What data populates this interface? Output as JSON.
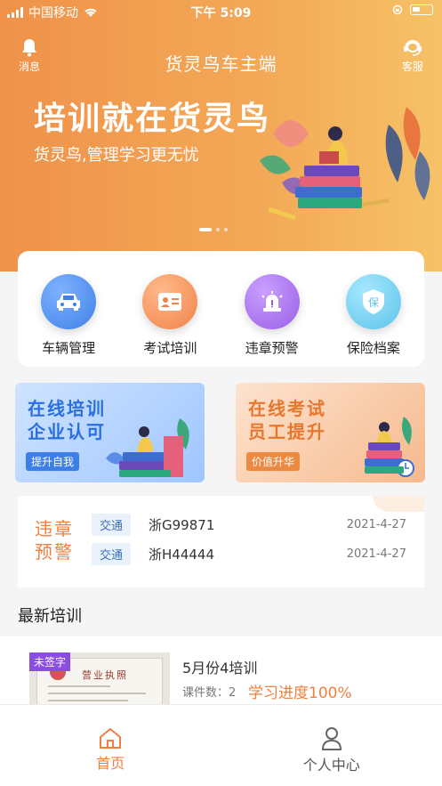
{
  "status_bar": {
    "carrier": "中国移动",
    "time": "下午 5:09"
  },
  "header": {
    "title": "货灵鸟车主端",
    "messages_label": "消息",
    "service_label": "客服"
  },
  "banner": {
    "headline": "培训就在货灵鸟",
    "subline": "货灵鸟,管理学习更无忧",
    "page_count": 3,
    "active_page": 1
  },
  "quick_entries": [
    {
      "label": "车辆管理",
      "icon": "car-icon",
      "color": "#3f80e8"
    },
    {
      "label": "考试培训",
      "icon": "id-card-icon",
      "color": "#f0834a"
    },
    {
      "label": "违章预警",
      "icon": "siren-icon",
      "color": "#9a5de6"
    },
    {
      "label": "保险档案",
      "icon": "shield-icon",
      "color": "#5cc3e8",
      "badge": "保"
    }
  ],
  "promos": [
    {
      "title_line1": "在线培训",
      "title_line2": "企业认可",
      "tag": "提升自我"
    },
    {
      "title_line1": "在线考试",
      "title_line2": "员工提升",
      "tag": "价值升华"
    }
  ],
  "violations": {
    "label_line1": "违章",
    "label_line2": "预警",
    "items": [
      {
        "type": "交通",
        "plate": "浙G99871",
        "date": "2021-4-27"
      },
      {
        "type": "交通",
        "plate": "浙H44444",
        "date": "2021-4-27"
      }
    ]
  },
  "latest_training": {
    "section_title": "最新培训",
    "items": [
      {
        "badge": "未签字",
        "doc_heading": "营业执照",
        "name": "5月份4培训",
        "count_label": "课件数：2",
        "progress": "学习进度100%"
      }
    ]
  },
  "tabbar": {
    "home_label": "首页",
    "profile_label": "个人中心",
    "active": "home"
  }
}
